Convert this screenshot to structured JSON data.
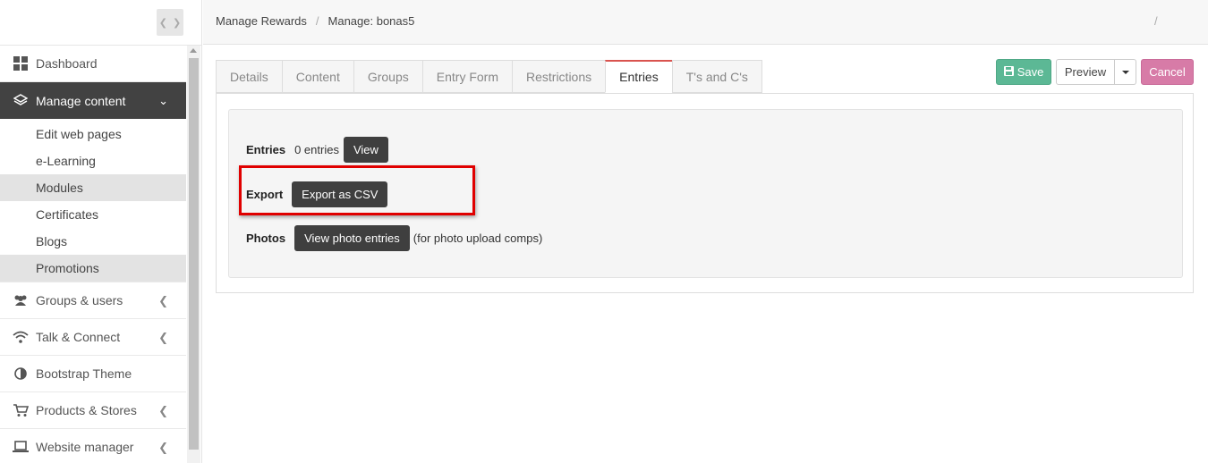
{
  "breadcrumbs": [
    "Manage Rewards",
    "Manage: bonas5"
  ],
  "breadcrumb_separator": "/",
  "topbar_trailing": "/",
  "sidebar": {
    "items": [
      {
        "label": "Dashboard",
        "icon": "grid-icon"
      },
      {
        "label": "Manage content",
        "icon": "layers-icon",
        "active": true,
        "expanded": true,
        "children": [
          "Edit web pages",
          "e-Learning",
          "Modules",
          "Certificates",
          "Blogs",
          "Promotions"
        ],
        "highlighted_children": [
          "Modules",
          "Promotions"
        ]
      },
      {
        "label": "Groups & users",
        "icon": "users-icon"
      },
      {
        "label": "Talk & Connect",
        "icon": "wifi-icon"
      },
      {
        "label": "Bootstrap Theme",
        "icon": "contrast-icon"
      },
      {
        "label": "Products & Stores",
        "icon": "cart-icon"
      },
      {
        "label": "Website manager",
        "icon": "laptop-icon"
      }
    ]
  },
  "tabs": [
    "Details",
    "Content",
    "Groups",
    "Entry Form",
    "Restrictions",
    "Entries",
    "T's and C's"
  ],
  "active_tab": "Entries",
  "actions": {
    "save": "Save",
    "preview": "Preview",
    "cancel": "Cancel"
  },
  "entries_panel": {
    "entries_label": "Entries",
    "entries_count": "0 entries",
    "view_button": "View",
    "export_label": "Export",
    "export_button": "Export as CSV",
    "photos_label": "Photos",
    "photos_button": "View photo entries",
    "photos_note": "(for photo upload comps)"
  },
  "colors": {
    "save": "#5cb895",
    "cancel": "#d77ba7",
    "active_nav": "#424242",
    "active_tab_accent": "#d9534f",
    "annotation_box": "#e00000"
  }
}
